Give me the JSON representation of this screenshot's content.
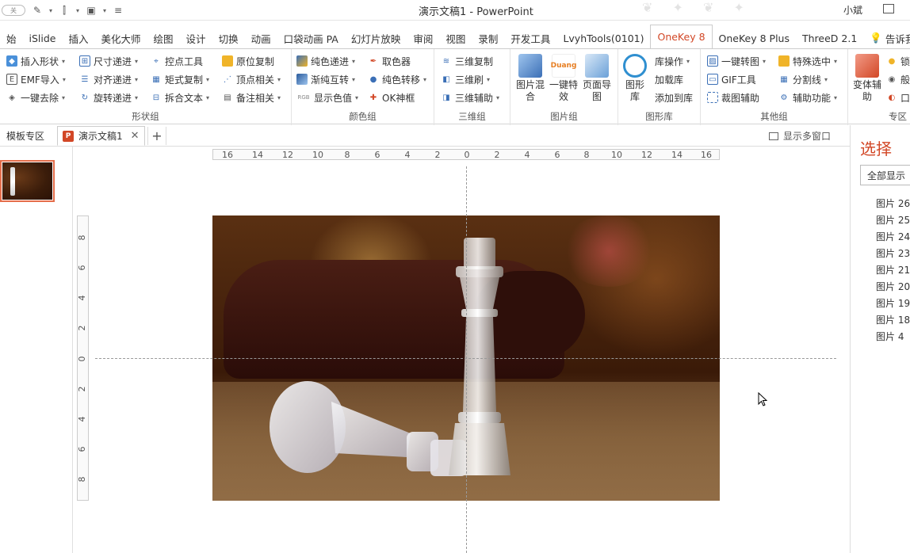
{
  "window": {
    "title": "演示文稿1  -  PowerPoint",
    "user": "小斌",
    "toggle_label": "关"
  },
  "tabs": [
    "始",
    "iSlide",
    "插入",
    "美化大师",
    "绘图",
    "设计",
    "切换",
    "动画",
    "口袋动画 PA",
    "幻灯片放映",
    "审阅",
    "视图",
    "录制",
    "开发工具",
    "LvyhTools(0101)",
    "OneKey 8",
    "OneKey 8 Plus",
    "ThreeD 2.1",
    "告诉我"
  ],
  "active_tab": "OneKey 8",
  "ribbon": {
    "shape_group": {
      "label": "形状组",
      "items": [
        "插入形状",
        "尺寸递进",
        "控点工具",
        "原位复制",
        "EMF导入",
        "对齐递进",
        "矩式复制",
        "顶点相关",
        "一键去除",
        "旋转递进",
        "拆合文本",
        "备注相关"
      ]
    },
    "color_group": {
      "label": "颜色组",
      "items": [
        "纯色递进",
        "取色器",
        "渐纯互转",
        "纯色转移",
        "显示色值",
        "OK神框"
      ]
    },
    "3d_group": {
      "label": "三维组",
      "items": [
        "三维复制",
        "三维刷",
        "三维辅助"
      ]
    },
    "image_group": {
      "label": "图片组",
      "items": [
        "图片混合",
        "一键特效",
        "页面导图"
      ],
      "duang_label": "Duang"
    },
    "shape_lib_group": {
      "label": "图形库",
      "items": [
        "图形库",
        "库操作",
        "加载库",
        "添加到库"
      ]
    },
    "other_group": {
      "label": "其他组",
      "items": [
        "一键转图",
        "特殊选中",
        "GIF工具",
        "分割线",
        "裁图辅助",
        "辅助功能"
      ]
    },
    "extra_group": {
      "label": "专区",
      "items": [
        "变体辅助",
        "锁",
        "般",
        "口"
      ]
    },
    "rgb_label": "RGB"
  },
  "doc_tabs": {
    "template_zone": "模板专区",
    "active_doc": "演示文稿1",
    "ppt_badge": "P",
    "multi_window": "显示多窗口"
  },
  "rulers": {
    "horizontal": [
      "16",
      "14",
      "12",
      "10",
      "8",
      "6",
      "4",
      "2",
      "0",
      "2",
      "4",
      "6",
      "8",
      "10",
      "12",
      "14",
      "16"
    ],
    "vertical": [
      "8",
      "6",
      "4",
      "2",
      "0",
      "2",
      "4",
      "6",
      "8"
    ]
  },
  "selection_pane": {
    "title": "选择",
    "show_all": "全部显示",
    "items": [
      "图片 26",
      "图片 25",
      "图片 24",
      "图片 23",
      "图片 21",
      "图片 20",
      "图片 19",
      "图片 18",
      "图片 4"
    ]
  }
}
